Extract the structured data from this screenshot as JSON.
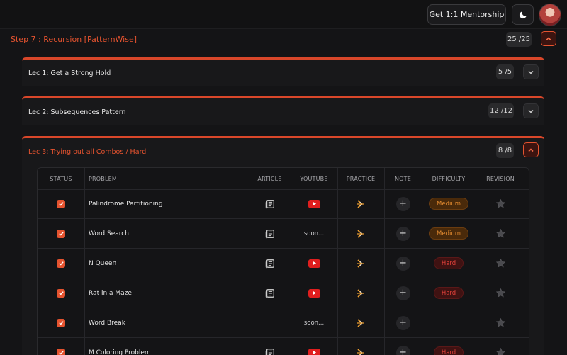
{
  "header": {
    "mentorship_label": "Get 1:1 Mentorship",
    "theme_icon": "moon-icon",
    "avatar_icon": "user-avatar"
  },
  "step": {
    "title": "Step 7 : Recursion [PatternWise]",
    "count": "25 /25"
  },
  "lectures": [
    {
      "title": "Lec 1: Get a Strong Hold",
      "count": "5 /5"
    },
    {
      "title": "Lec 2: Subsequences Pattern",
      "count": "12 /12"
    },
    {
      "title": "Lec 3: Trying out all Combos / Hard",
      "count": "8 /8"
    }
  ],
  "table": {
    "headers": [
      "STATUS",
      "PROBLEM",
      "ARTICLE",
      "YOUTUBE",
      "PRACTICE",
      "NOTE",
      "DIFFICULTY",
      "REVISION"
    ],
    "rows": [
      {
        "problem": "Palindrome Partitioning",
        "article": true,
        "youtube": "video",
        "difficulty": "Medium"
      },
      {
        "problem": "Word Search",
        "article": true,
        "youtube": "soon...",
        "difficulty": "Medium"
      },
      {
        "problem": "N Queen",
        "article": true,
        "youtube": "video",
        "difficulty": "Hard"
      },
      {
        "problem": "Rat in a Maze",
        "article": true,
        "youtube": "video",
        "difficulty": "Hard"
      },
      {
        "problem": "Word Break",
        "article": false,
        "youtube": "soon...",
        "difficulty": ""
      },
      {
        "problem": "M Coloring Problem",
        "article": true,
        "youtube": "video",
        "difficulty": "Hard"
      }
    ]
  },
  "colors": {
    "accent": "#e5532f",
    "medium": "#e0892f",
    "hard": "#e2413a",
    "youtube": "#e01e1e"
  }
}
